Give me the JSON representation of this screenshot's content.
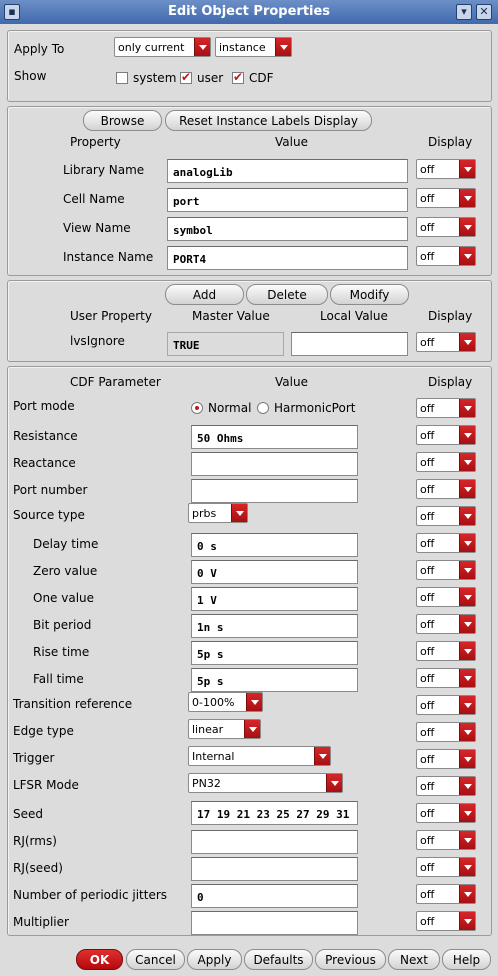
{
  "window": {
    "title": "Edit Object Properties"
  },
  "apply_section": {
    "apply_to_label": "Apply To",
    "apply_scope": "only current",
    "apply_target": "instance",
    "show_label": "Show",
    "show_options": [
      {
        "label": "system",
        "checked": false
      },
      {
        "label": "user",
        "checked": true
      },
      {
        "label": "CDF",
        "checked": true
      }
    ]
  },
  "instance_section": {
    "browse_label": "Browse",
    "reset_label": "Reset Instance Labels Display",
    "col_property": "Property",
    "col_value": "Value",
    "col_display": "Display",
    "rows": [
      {
        "label": "Library Name",
        "value": "analogLib",
        "display": "off"
      },
      {
        "label": "Cell Name",
        "value": "port",
        "display": "off"
      },
      {
        "label": "View Name",
        "value": "symbol",
        "display": "off"
      },
      {
        "label": "Instance Name",
        "value": "PORT4",
        "display": "off"
      }
    ]
  },
  "user_section": {
    "add_label": "Add",
    "delete_label": "Delete",
    "modify_label": "Modify",
    "col_user_property": "User Property",
    "col_master_value": "Master Value",
    "col_local_value": "Local Value",
    "col_display": "Display",
    "rows": [
      {
        "label": "lvsIgnore",
        "master": "TRUE",
        "local": "",
        "display": "off"
      }
    ]
  },
  "cdf_section": {
    "col_param": "CDF Parameter",
    "col_value": "Value",
    "col_display": "Display",
    "port_mode": {
      "label": "Port mode",
      "options": [
        "Normal",
        "HarmonicPort"
      ],
      "selected": "Normal",
      "display": "off"
    },
    "params": [
      {
        "label": "Resistance",
        "value": "50 Ohms",
        "display": "off"
      },
      {
        "label": "Reactance",
        "value": "",
        "display": "off"
      },
      {
        "label": "Port number",
        "value": "",
        "display": "off"
      },
      {
        "label": "Source type",
        "value": "prbs",
        "display": "off"
      },
      {
        "label": "Delay time",
        "value": "0 s",
        "display": "off"
      },
      {
        "label": "Zero value",
        "value": "0 V",
        "display": "off"
      },
      {
        "label": "One value",
        "value": "1 V",
        "display": "off"
      },
      {
        "label": "Bit period",
        "value": "1n s",
        "display": "off"
      },
      {
        "label": "Rise time",
        "value": "5p s",
        "display": "off"
      },
      {
        "label": "Fall time",
        "value": "5p s",
        "display": "off"
      },
      {
        "label": "Transition reference",
        "value": "0-100%",
        "display": "off"
      },
      {
        "label": "Edge type",
        "value": "linear",
        "display": "off"
      },
      {
        "label": "Trigger",
        "value": "Internal",
        "display": "off"
      },
      {
        "label": "LFSR Mode",
        "value": "PN32",
        "display": "off"
      },
      {
        "label": "Seed",
        "value": "17 19 21 23 25 27 29 31",
        "display": "off"
      },
      {
        "label": "RJ(rms)",
        "value": "",
        "display": "off"
      },
      {
        "label": "RJ(seed)",
        "value": "",
        "display": "off"
      },
      {
        "label": "Number of periodic jitters",
        "value": "0",
        "display": "off"
      },
      {
        "label": "Multiplier",
        "value": "",
        "display": "off"
      }
    ]
  },
  "footer": {
    "ok_label": "OK",
    "cancel_label": "Cancel",
    "apply_label": "Apply",
    "defaults_label": "Defaults",
    "previous_label": "Previous",
    "next_label": "Next",
    "help_label": "Help"
  },
  "colors": {
    "title_bar": "#3f69ad",
    "accent_red": "#c4161b",
    "background": "#dcdcdc"
  }
}
